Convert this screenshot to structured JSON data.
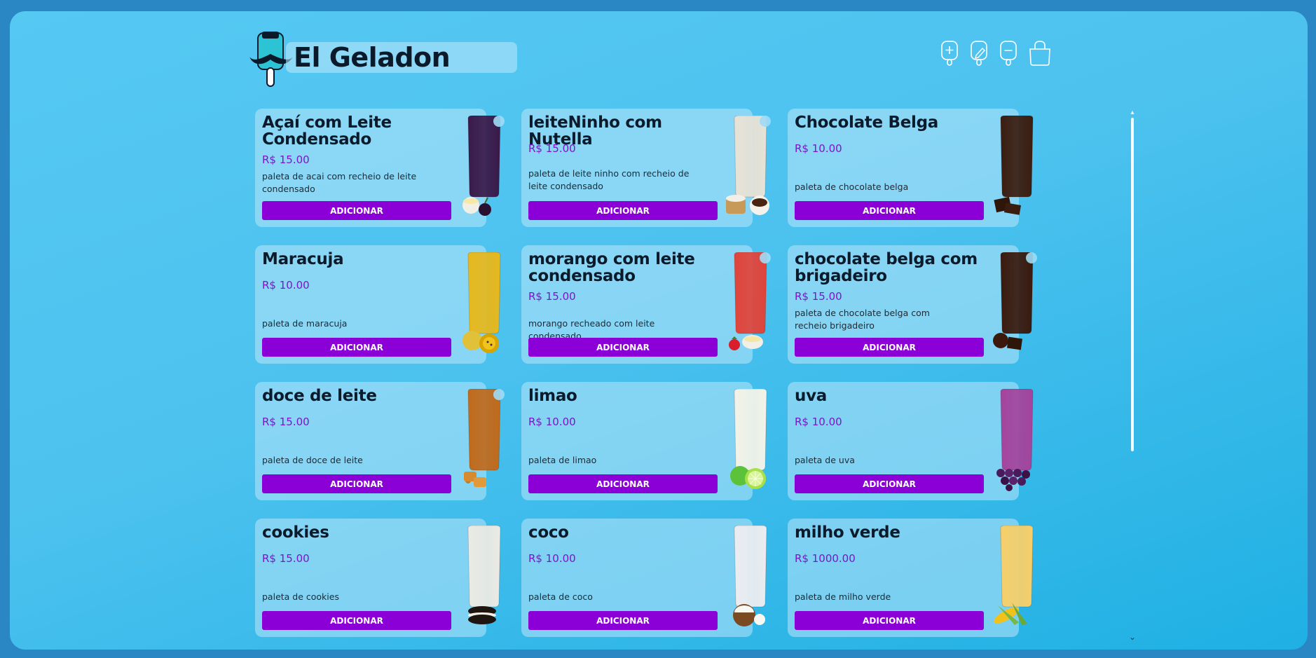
{
  "brand": {
    "title": "El Geladon"
  },
  "nav": [
    {
      "name": "add-product-button",
      "icon": "popsicle-plus-icon"
    },
    {
      "name": "edit-product-button",
      "icon": "popsicle-edit-icon"
    },
    {
      "name": "remove-product-button",
      "icon": "popsicle-minus-icon"
    },
    {
      "name": "cart-button",
      "icon": "shopping-bag-icon"
    }
  ],
  "products": [
    {
      "name": "Açaí com Leite Condensado",
      "price": "R$ 15.00",
      "description": "paleta de acai com recheio de leite condensado",
      "button": "ADICIONAR",
      "color": "#3a1a4a",
      "topping": "acai"
    },
    {
      "name": "leiteNinho com Nutella",
      "price": "R$ 15.00",
      "description": "paleta de leite ninho com recheio de leite condensado",
      "button": "ADICIONAR",
      "color": "#e8e2d6",
      "topping": "nutella"
    },
    {
      "name": "Chocolate Belga",
      "price": "R$ 10.00",
      "description": "paleta de chocolate belga",
      "button": "ADICIONAR",
      "color": "#3b1d10",
      "topping": "chocolate"
    },
    {
      "name": "Maracuja",
      "price": "R$ 10.00",
      "description": "paleta de maracuja",
      "button": "ADICIONAR",
      "color": "#e6b81d",
      "topping": "maracuja"
    },
    {
      "name": "morango com leite condensado",
      "price": "R$ 15.00",
      "description": "morango recheado com leite condensado",
      "button": "ADICIONAR",
      "color": "#e0443a",
      "topping": "morango"
    },
    {
      "name": "chocolate belga com brigadeiro",
      "price": "R$ 15.00",
      "description": "paleta de chocolate belga com recheio brigadeiro",
      "button": "ADICIONAR",
      "color": "#3a1a0e",
      "topping": "brigadeiro"
    },
    {
      "name": "doce de leite",
      "price": "R$ 15.00",
      "description": "paleta de doce de leite",
      "button": "ADICIONAR",
      "color": "#c06a1c",
      "topping": "caramelo"
    },
    {
      "name": "limao",
      "price": "R$ 10.00",
      "description": "paleta de limao",
      "button": "ADICIONAR",
      "color": "#f3f3e8",
      "topping": "limao"
    },
    {
      "name": "uva",
      "price": "R$ 10.00",
      "description": "paleta de uva",
      "button": "ADICIONAR",
      "color": "#a4449c",
      "topping": "uva"
    },
    {
      "name": "cookies",
      "price": "R$ 15.00",
      "description": "paleta de cookies",
      "button": "ADICIONAR",
      "color": "#eceae4",
      "topping": "cookie"
    },
    {
      "name": "coco",
      "price": "R$ 10.00",
      "description": "paleta de coco",
      "button": "ADICIONAR",
      "color": "#ecedf0",
      "topping": "coco"
    },
    {
      "name": "milho verde",
      "price": "R$ 1000.00",
      "description": "paleta de milho verde",
      "button": "ADICIONAR",
      "color": "#f7cf6a",
      "topping": "milho"
    }
  ],
  "colors": {
    "accent": "#8b00d6",
    "price": "#7a16c9",
    "background": "#4dc2ef"
  }
}
